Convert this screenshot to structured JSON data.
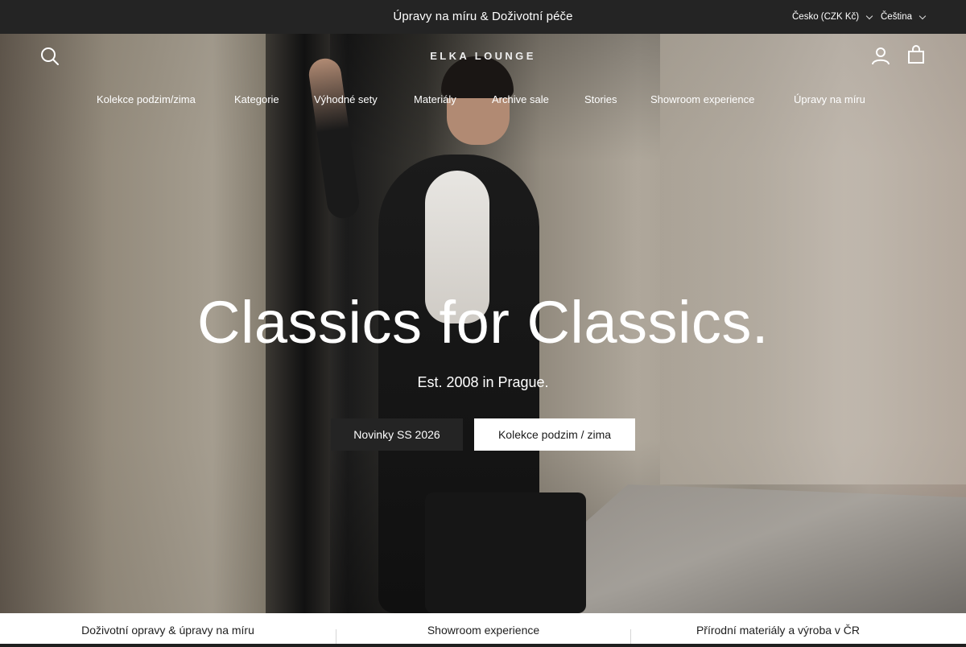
{
  "announcement": {
    "text": "Úpravy na míru & Doživotní péče",
    "country": "Česko (CZK Kč)",
    "language": "Čeština"
  },
  "header": {
    "logo": "ELKA LOUNGE",
    "icons": [
      "search-icon",
      "account-icon",
      "cart-icon"
    ],
    "nav": [
      "Kolekce podzim/zima",
      "Kategorie",
      "Výhodné sety",
      "Materiály",
      "Archive sale",
      "Stories",
      "Showroom experience",
      "Úpravy na míru"
    ]
  },
  "hero": {
    "title": "Classics for Classics.",
    "subtitle": "Est. 2008 in Prague.",
    "primary_button": "Novinky SS 2026",
    "secondary_button": "Kolekce podzim / zima"
  },
  "usp": [
    "Doživotní opravy & úpravy na míru",
    "Showroom experience",
    "Přírodní materiály a výroba v ČR"
  ],
  "colors": {
    "topbar": "#242424",
    "button_dark": "#242424",
    "button_light": "#ffffff",
    "text_light": "#ffffff"
  }
}
